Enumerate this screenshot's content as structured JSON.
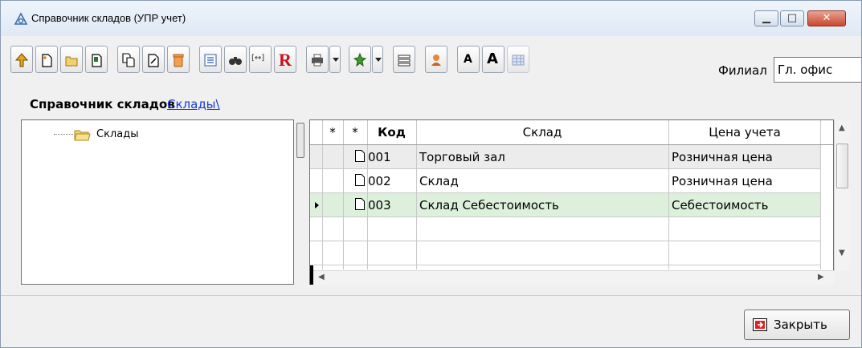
{
  "window": {
    "title": "Справочник складов (УПР учет)",
    "min_glyph": "▁",
    "max_glyph": "□",
    "close_glyph": "✕"
  },
  "toolbar": {
    "icons": [
      "up-arrow-icon",
      "new-item-icon",
      "new-folder-icon",
      "copy-item-icon",
      "duplicate-icon",
      "edit-icon",
      "delete-icon",
      "list-view-icon",
      "find-icon",
      "width-fit-icon",
      "report-icon",
      "print-icon",
      "print-dropdown",
      "filter-icon",
      "filter-dropdown",
      "columns-icon",
      "user-icon",
      "font-decrease-icon",
      "font-increase-icon",
      "table-icon"
    ],
    "report_glyph": "R",
    "font_small_glyph": "A",
    "font_large_glyph": "A",
    "width_fit_glyph": "[↔]",
    "filial_label": "Филиал",
    "filial_value": "Гл. офис"
  },
  "breadcrumb": {
    "title": "Справочник складов",
    "link": "Склады\\"
  },
  "tree": {
    "root_label": "Склады"
  },
  "grid": {
    "columns": {
      "star1": "*",
      "star2": "*",
      "code": "Код",
      "name": "Склад",
      "price": "Цена учета"
    },
    "rows": [
      {
        "code": "001",
        "name": "Торговый зал",
        "price": "Розничная цена"
      },
      {
        "code": "002",
        "name": "Склад",
        "price": "Розничная цена"
      },
      {
        "code": "003",
        "name": "Склад Себестоимость",
        "price": "Себестоимость"
      }
    ],
    "selected_row_color": "#dcf0dc",
    "first_row_color": "#ececec"
  },
  "footer": {
    "close_label": "Закрыть"
  }
}
